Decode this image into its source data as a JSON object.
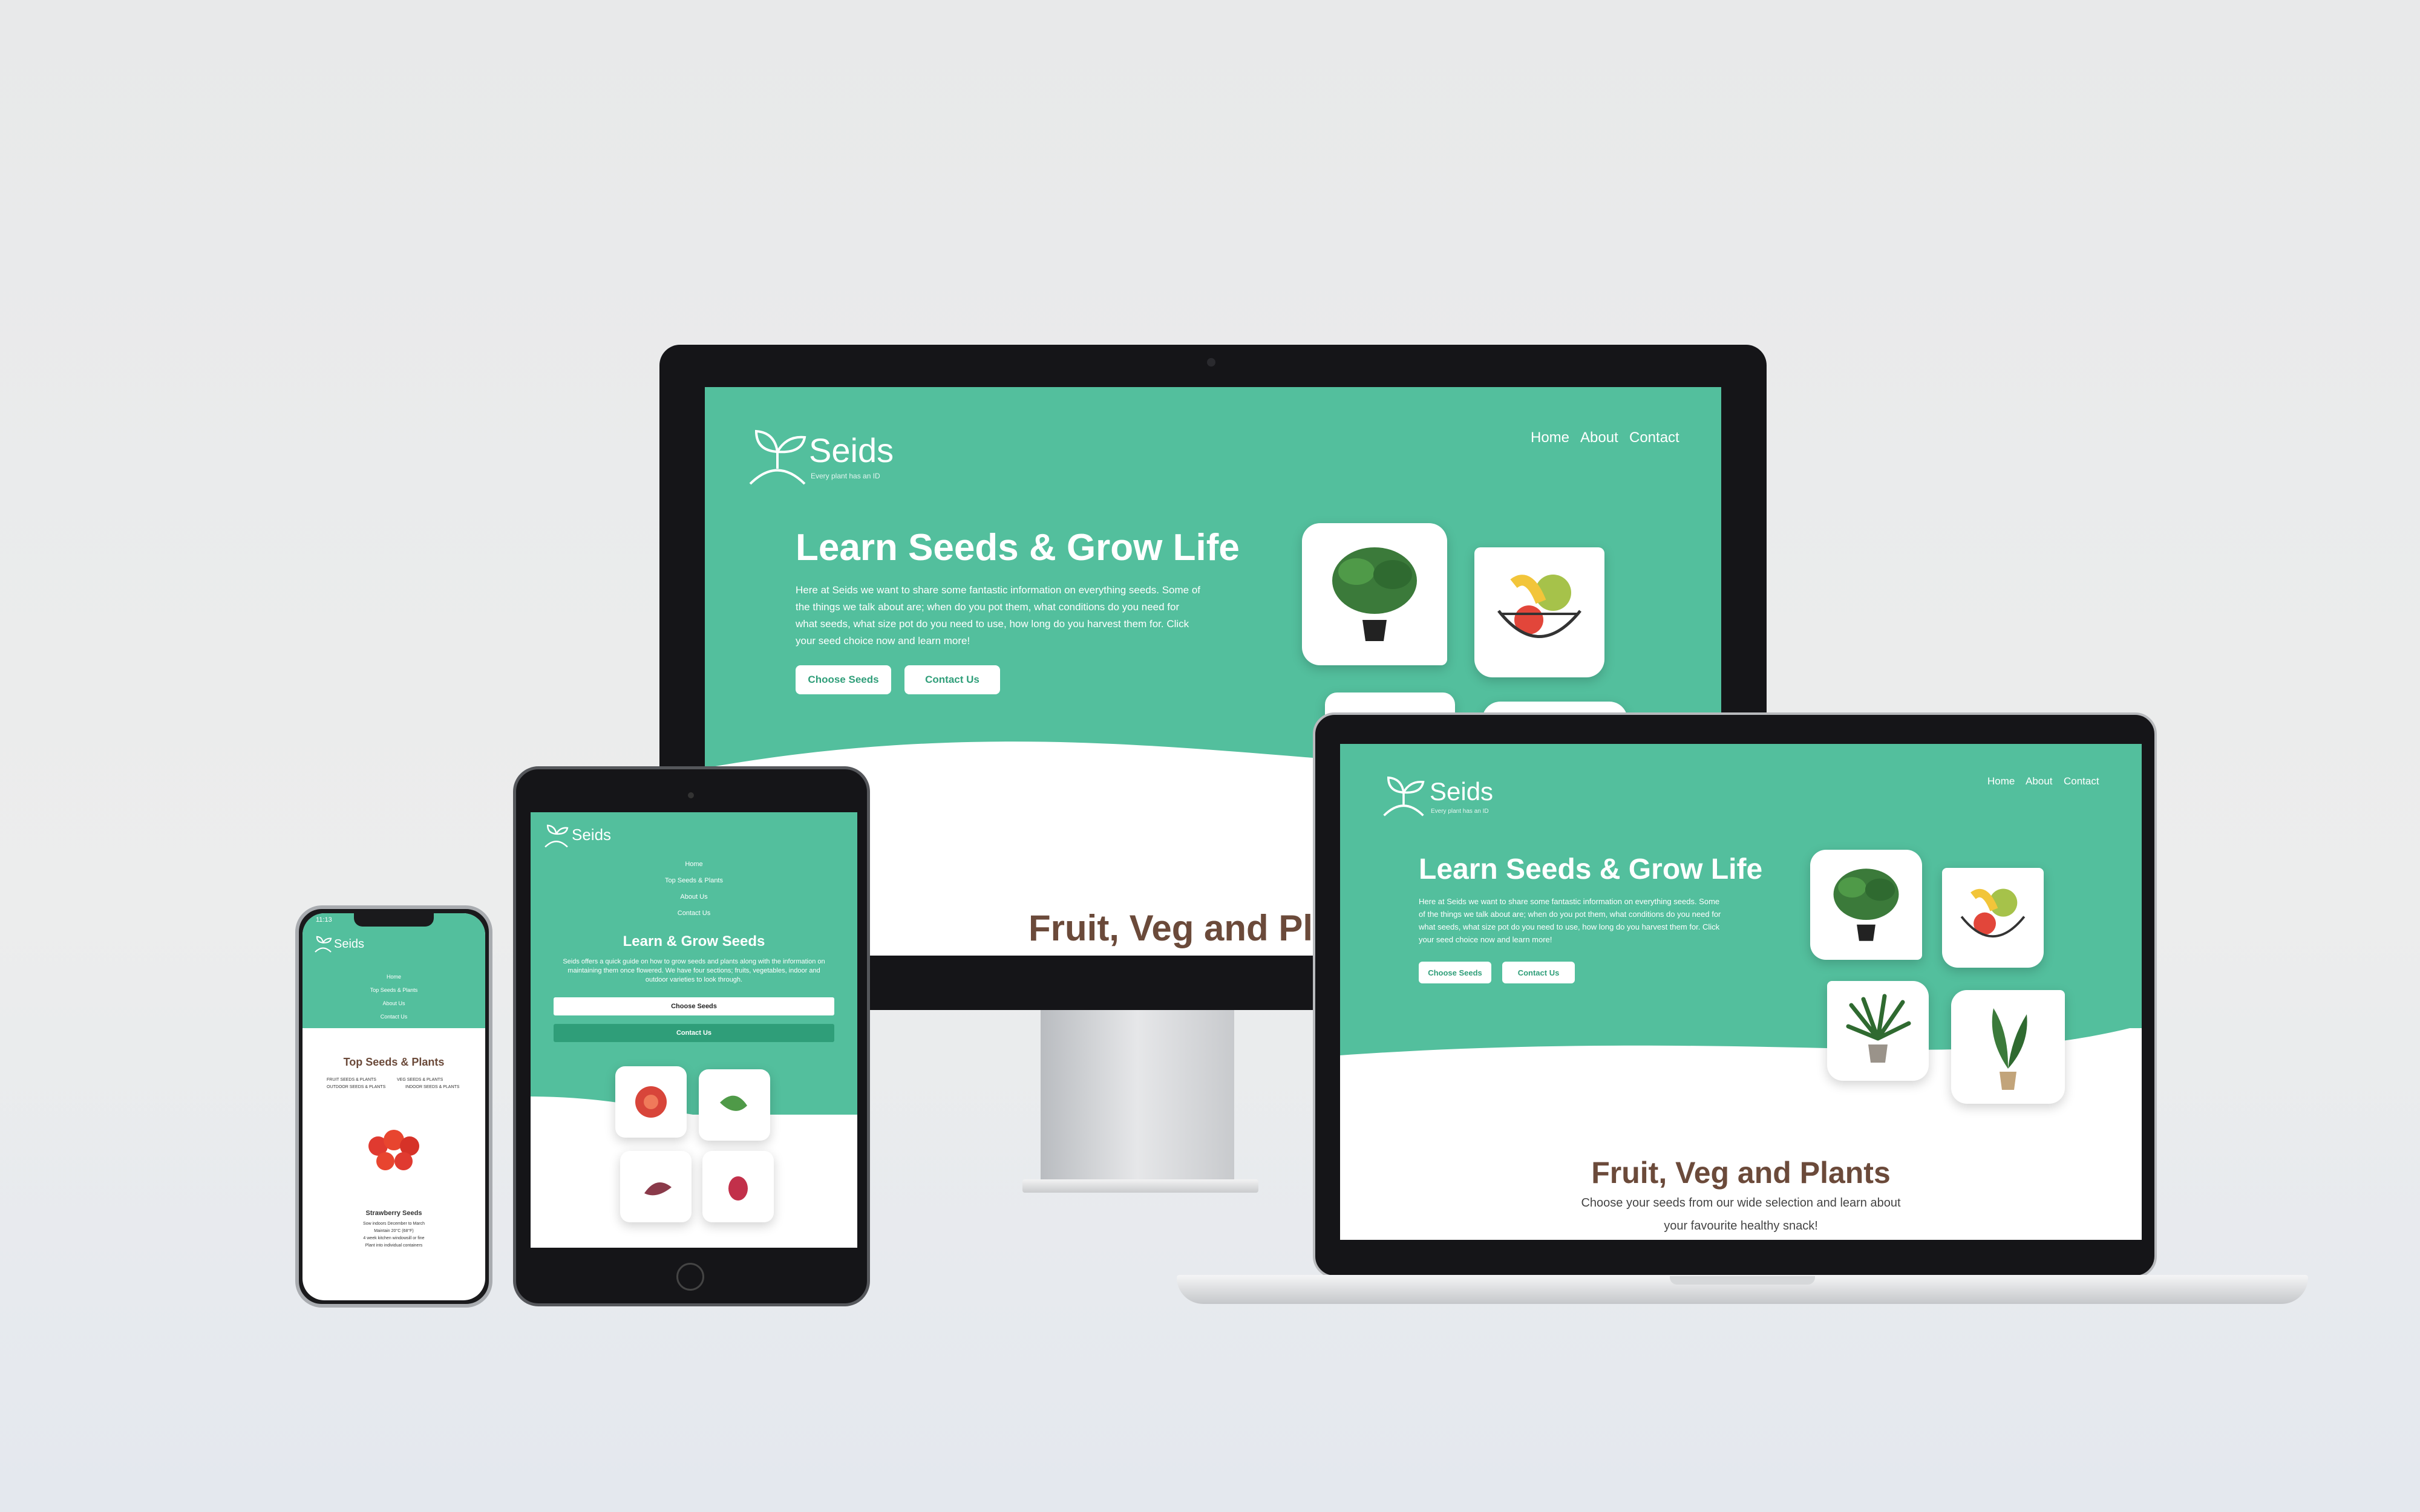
{
  "brand": {
    "name": "Seids",
    "tagline": "Every plant has an ID"
  },
  "nav": {
    "home": "Home",
    "about": "About",
    "contact": "Contact"
  },
  "hero": {
    "title": "Learn Seeds & Grow Life",
    "body": "Here at Seids we want to share some fantastic information on everything seeds. Some of the things we talk about are; when do you pot them, what conditions do you need for what seeds, what size pot do you need to use, how long do you harvest them for. Click your seed choice now and learn more!",
    "btn_choose": "Choose Seeds",
    "btn_contact": "Contact Us"
  },
  "section": {
    "title": "Fruit, Veg and Plants",
    "title_partial": "Fruit, Veg and Pl",
    "subtitle_line1": "Choose your seeds from our wide selection and learn about",
    "subtitle_line2": "your favourite healthy snack!"
  },
  "tablet": {
    "menu": [
      "Home",
      "Top Seeds & Plants",
      "About Us",
      "Contact Us"
    ],
    "title": "Learn & Grow Seeds",
    "body": "Seids offers a quick guide on how to grow seeds and plants along with the information on maintaining them once flowered. We have four sections; fruits, vegetables, indoor and outdoor varieties to look through.",
    "btn_choose": "Choose Seeds",
    "btn_contact": "Contact Us"
  },
  "phone": {
    "time": "11:13",
    "menu": [
      "Home",
      "Top Seeds & Plants",
      "About Us",
      "Contact Us"
    ],
    "section_title": "Top Seeds & Plants",
    "categories": [
      "FRUIT SEEDS & PLANTS",
      "VEG SEEDS & PLANTS",
      "OUTDOOR SEEDS & PLANTS",
      "INDOOR SEEDS & PLANTS"
    ],
    "product_title": "Strawberry Seeds",
    "product_points": [
      "Sow indoors December to March",
      "Maintain 20°C (68°F)",
      "4 week kitchen windowsill or fine",
      "Plant into individual containers"
    ]
  },
  "colors": {
    "primary": "#53bf9d",
    "brown": "#6b4a3a",
    "bezel": "#151518"
  }
}
